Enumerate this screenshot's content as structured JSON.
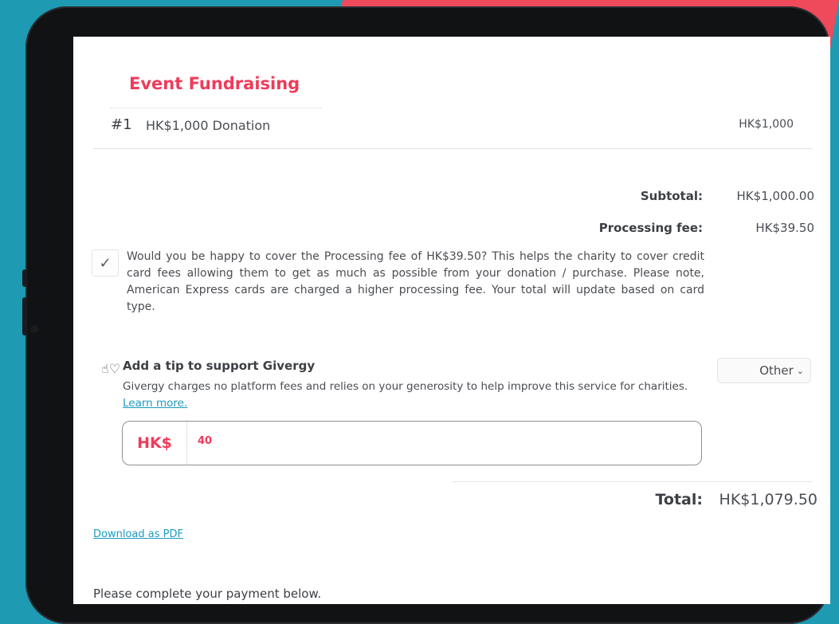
{
  "event": {
    "section_title": "Event Fundraising",
    "item_number": "#1",
    "item_label": "HK$1,000 Donation",
    "item_price": "HK$1,000"
  },
  "summary": {
    "subtotal_label": "Subtotal:",
    "subtotal_value": "HK$1,000.00",
    "fee_label": "Processing fee:",
    "fee_value": "HK$39.50"
  },
  "cover_fee": {
    "checked": true,
    "text": "Would you be happy to cover the Processing fee of HK$39.50? This helps the charity to cover credit card fees allowing them to get as much as possible from your donation / purchase. Please note, American Express cards are charged a higher processing fee. Your total will update based on card type."
  },
  "tip": {
    "icon": "hand-heart-icon",
    "title": "Add a tip to support Givergy",
    "description": "Givergy charges no platform fees and relies on your generosity to help improve this service for charities.",
    "learn_more": "Learn more.",
    "select_value": "Other",
    "currency": "HK$",
    "amount": "40"
  },
  "total": {
    "label": "Total:",
    "value": "HK$1,079.50"
  },
  "download_pdf": "Download as PDF",
  "payment_note": "Please complete your payment below.",
  "colors": {
    "accent": "#ef3b5a",
    "link": "#1d9bc2",
    "background": "#1f9ab3",
    "background_accent": "#ee4a5c"
  }
}
